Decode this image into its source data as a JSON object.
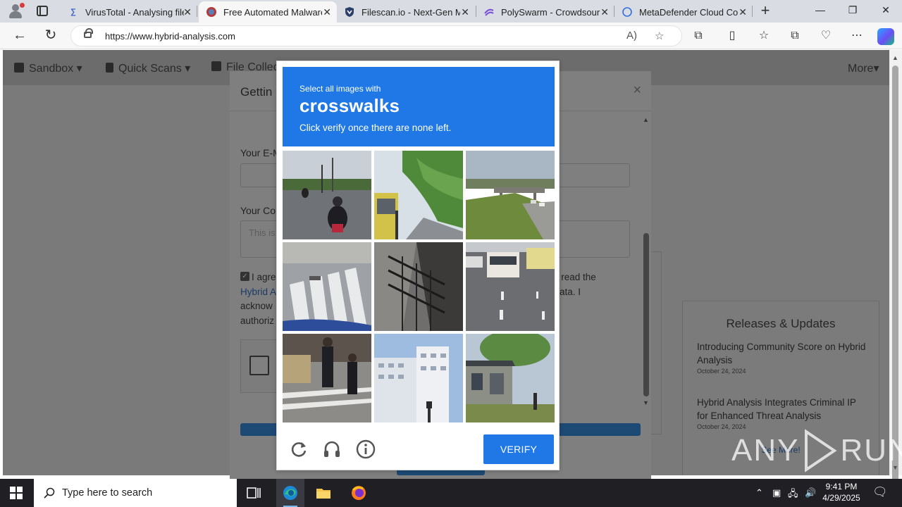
{
  "browser": {
    "tabs": [
      {
        "title": "VirusTotal - Analysing file",
        "icon": "virustotal-icon",
        "active": false
      },
      {
        "title": "Free Automated Malware",
        "icon": "hybrid-analysis-icon",
        "active": true
      },
      {
        "title": "Filescan.io - Next-Gen M",
        "icon": "filescan-icon",
        "active": false
      },
      {
        "title": "PolySwarm - Crowdsourc",
        "icon": "polyswarm-icon",
        "active": false
      },
      {
        "title": "MetaDefender Cloud Co",
        "icon": "metadefender-icon",
        "active": false
      }
    ],
    "url": "https://www.hybrid-analysis.com"
  },
  "site": {
    "nav": {
      "sandbox": "Sandbox",
      "quick_scans": "Quick Scans",
      "file_collections": "File Collec",
      "more": "More"
    },
    "releases": {
      "heading": "Releases & Updates",
      "items": [
        {
          "title": "Introducing Community Score on Hybrid Analysis",
          "date": "October 24, 2024"
        },
        {
          "title": "Hybrid Analysis Integrates Criminal IP for Enhanced Threat Analysis",
          "date": "October 24, 2024"
        }
      ],
      "see_more": "See More!"
    }
  },
  "modal": {
    "title": "Gettin",
    "email_label": "Your E-M",
    "comment_label": "Your Co",
    "comment_placeholder": "This is",
    "agree_line1_a": "I agre",
    "agree_line1_b": "e read the",
    "agree_line2_link": "Hybrid A",
    "agree_line2_b": "ata. I",
    "agree_line3": "acknow",
    "agree_line4": "authoriz"
  },
  "captcha": {
    "prompt_small": "Select all images with",
    "prompt_target": "crosswalks",
    "prompt_hint": "Click verify once there are none left.",
    "verify_label": "VERIFY",
    "tiles": [
      "motorcyclist-road",
      "bus-tree-lined-street",
      "highway-overpass",
      "crosswalk-closeup",
      "stairwell-railing",
      "bus-road-lanes",
      "pedestrians-crosswalk",
      "white-building",
      "house-street-corner"
    ]
  },
  "watermark": {
    "left": "ANY",
    "right": "RUN"
  },
  "taskbar": {
    "search_placeholder": "Type here to search",
    "time": "9:41 PM",
    "date": "4/29/2025"
  }
}
